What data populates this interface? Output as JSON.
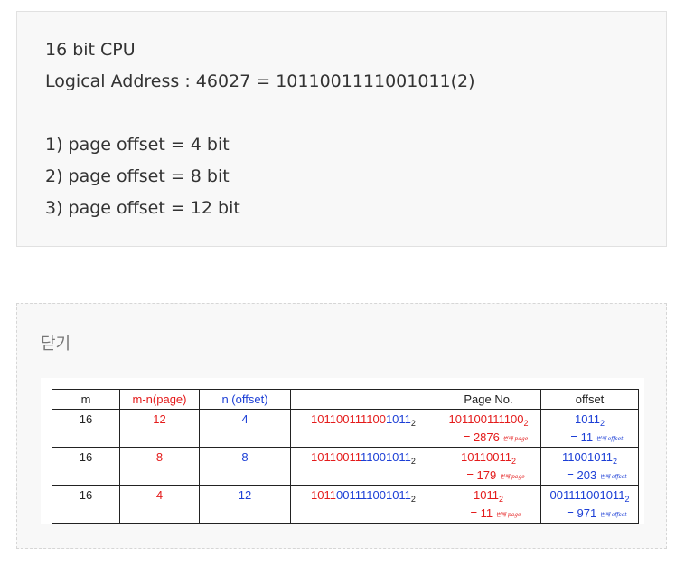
{
  "quiz": {
    "line1": "16 bit CPU",
    "line2": "Logical Address : 46027 = 1011001111001011(2)",
    "q1": "1) page offset = 4 bit",
    "q2": "2) page offset = 8 bit",
    "q3": "3) page offset = 12 bit"
  },
  "answer": {
    "toggle": "닫기",
    "table": {
      "headers": [
        "m",
        "m-n(page)",
        "n (offset)",
        "",
        "Page No.",
        "offset"
      ],
      "sub": "2",
      "rows": [
        {
          "m": "16",
          "mn": "12",
          "n": "4",
          "bin_page": "101100111100",
          "bin_off": "1011",
          "page_bin": "101100111100",
          "page_dec": "= 2876",
          "page_note": "번째 page",
          "off_bin": "1011",
          "off_dec": "= 11",
          "off_note": "번째 offset"
        },
        {
          "m": "16",
          "mn": "8",
          "n": "8",
          "bin_page": "10110011",
          "bin_off": "11001011",
          "page_bin": "10110011",
          "page_dec": "= 179",
          "page_note": "번째 page",
          "off_bin": "11001011",
          "off_dec": "= 203",
          "off_note": "번째 offset"
        },
        {
          "m": "16",
          "mn": "4",
          "n": "12",
          "bin_page": "1011",
          "bin_off": "001111001011",
          "page_bin": "1011",
          "page_dec": "= 11",
          "page_note": "번째 page",
          "off_bin": "001111001011",
          "off_dec": "= 971",
          "off_note": "번째 offset"
        }
      ]
    }
  },
  "colors": {
    "page": "#e41b1b",
    "offset": "#1c3fd6"
  }
}
